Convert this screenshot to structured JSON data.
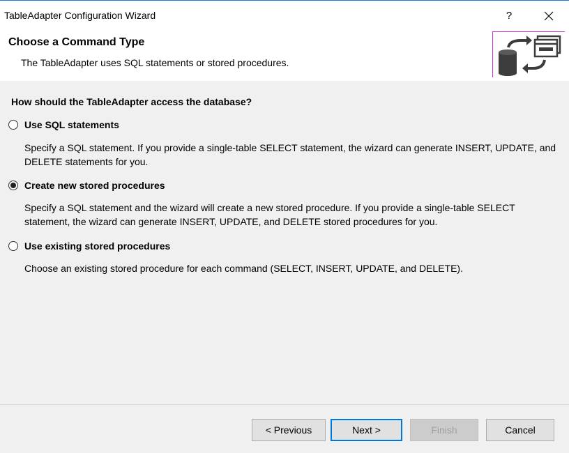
{
  "window": {
    "title": "TableAdapter Configuration Wizard",
    "help_label": "?",
    "close_icon": "close-icon"
  },
  "header": {
    "title": "Choose a Command Type",
    "subtitle": "The TableAdapter uses SQL statements or stored procedures.",
    "icon": "database-sync-icon"
  },
  "main": {
    "question": "How should the TableAdapter access the database?",
    "options": [
      {
        "label": "Use SQL statements",
        "selected": false,
        "description": "Specify a SQL statement. If you provide a single-table SELECT statement, the wizard can generate INSERT, UPDATE, and DELETE statements for you."
      },
      {
        "label": "Create new stored procedures",
        "selected": true,
        "description": "Specify a SQL statement and the wizard will create a new stored procedure. If you provide a single-table SELECT statement, the wizard can generate INSERT, UPDATE, and DELETE stored procedures for you."
      },
      {
        "label": "Use existing stored procedures",
        "selected": false,
        "description": "Choose an existing stored procedure for each command (SELECT, INSERT, UPDATE, and DELETE)."
      }
    ]
  },
  "footer": {
    "previous_label": "< Previous",
    "next_label": "Next >",
    "finish_label": "Finish",
    "cancel_label": "Cancel",
    "finish_enabled": false
  },
  "colors": {
    "accent": "#0078d7",
    "title_border": "#1979ca",
    "icon_frame": "#cc33cc"
  }
}
